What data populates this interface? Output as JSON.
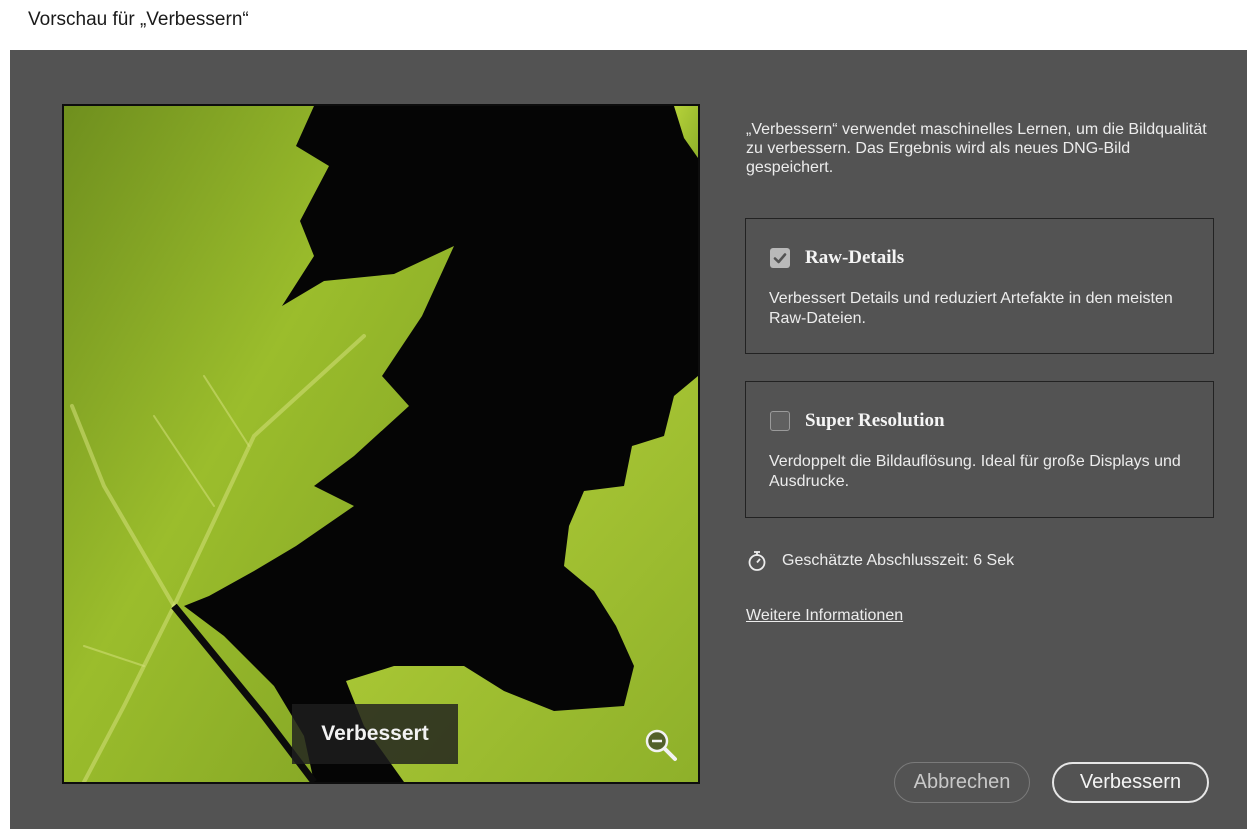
{
  "window": {
    "title": "Vorschau für „Verbessern“"
  },
  "preview": {
    "badge_label": "Verbessert",
    "zoom_icon": "zoom-out-magnifier-icon"
  },
  "info": {
    "description": "„Verbessern“ verwendet maschinelles Lernen, um die Bildqualität zu verbessern. Das Ergebnis wird als neues DNG-Bild gespeichert."
  },
  "options": [
    {
      "title": "Raw-Details",
      "checked": true,
      "description": "Verbessert Details und reduziert Artefakte in den meisten Raw-Dateien."
    },
    {
      "title": "Super Resolution",
      "checked": false,
      "description": "Verdoppelt die Bildauflösung. Ideal für große Displays und Ausdrucke."
    }
  ],
  "estimate": {
    "icon": "stopwatch-icon",
    "text": "Geschätzte Abschlusszeit: 6 Sek"
  },
  "more_info_link": "Weitere Informationen",
  "buttons": {
    "cancel": "Abbrechen",
    "confirm": "Verbessern"
  },
  "colors": {
    "dialog_background": "#535353",
    "leaf_green": "#a4c630",
    "preview_background": "#050505"
  }
}
